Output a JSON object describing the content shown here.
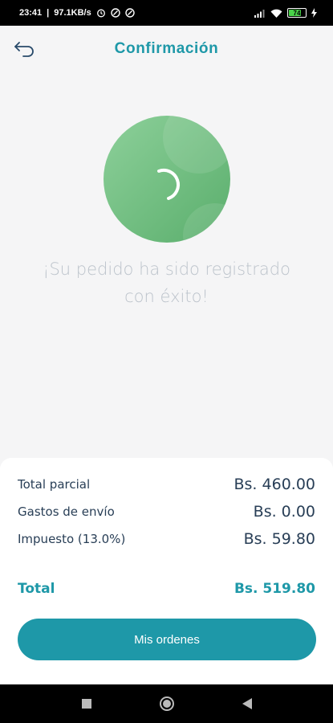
{
  "status_bar": {
    "time": "23:41",
    "speed": "97.1KB/s",
    "battery": "74"
  },
  "header": {
    "title": "Confirmación"
  },
  "success": {
    "line1": "¡Su pedido ha sido registrado",
    "line2": "con éxito!"
  },
  "summary": {
    "rows": [
      {
        "label": "Total parcial",
        "value": "Bs. 460.00"
      },
      {
        "label": "Gastos de envío",
        "value": "Bs. 0.00"
      },
      {
        "label": "Impuesto (13.0%)",
        "value": "Bs. 59.80"
      }
    ],
    "total": {
      "label": "Total",
      "value": "Bs. 519.80"
    }
  },
  "cta": {
    "label": "Mis ordenes"
  },
  "colors": {
    "accent": "#1e98a8",
    "success_circle": "#79c486",
    "text_dark": "#283e56"
  },
  "icons": {
    "back": "back-arrow-icon",
    "spinner": "loading-spinner-icon",
    "nav_recent": "square-icon",
    "nav_home": "circle-icon",
    "nav_back": "triangle-back-icon"
  }
}
